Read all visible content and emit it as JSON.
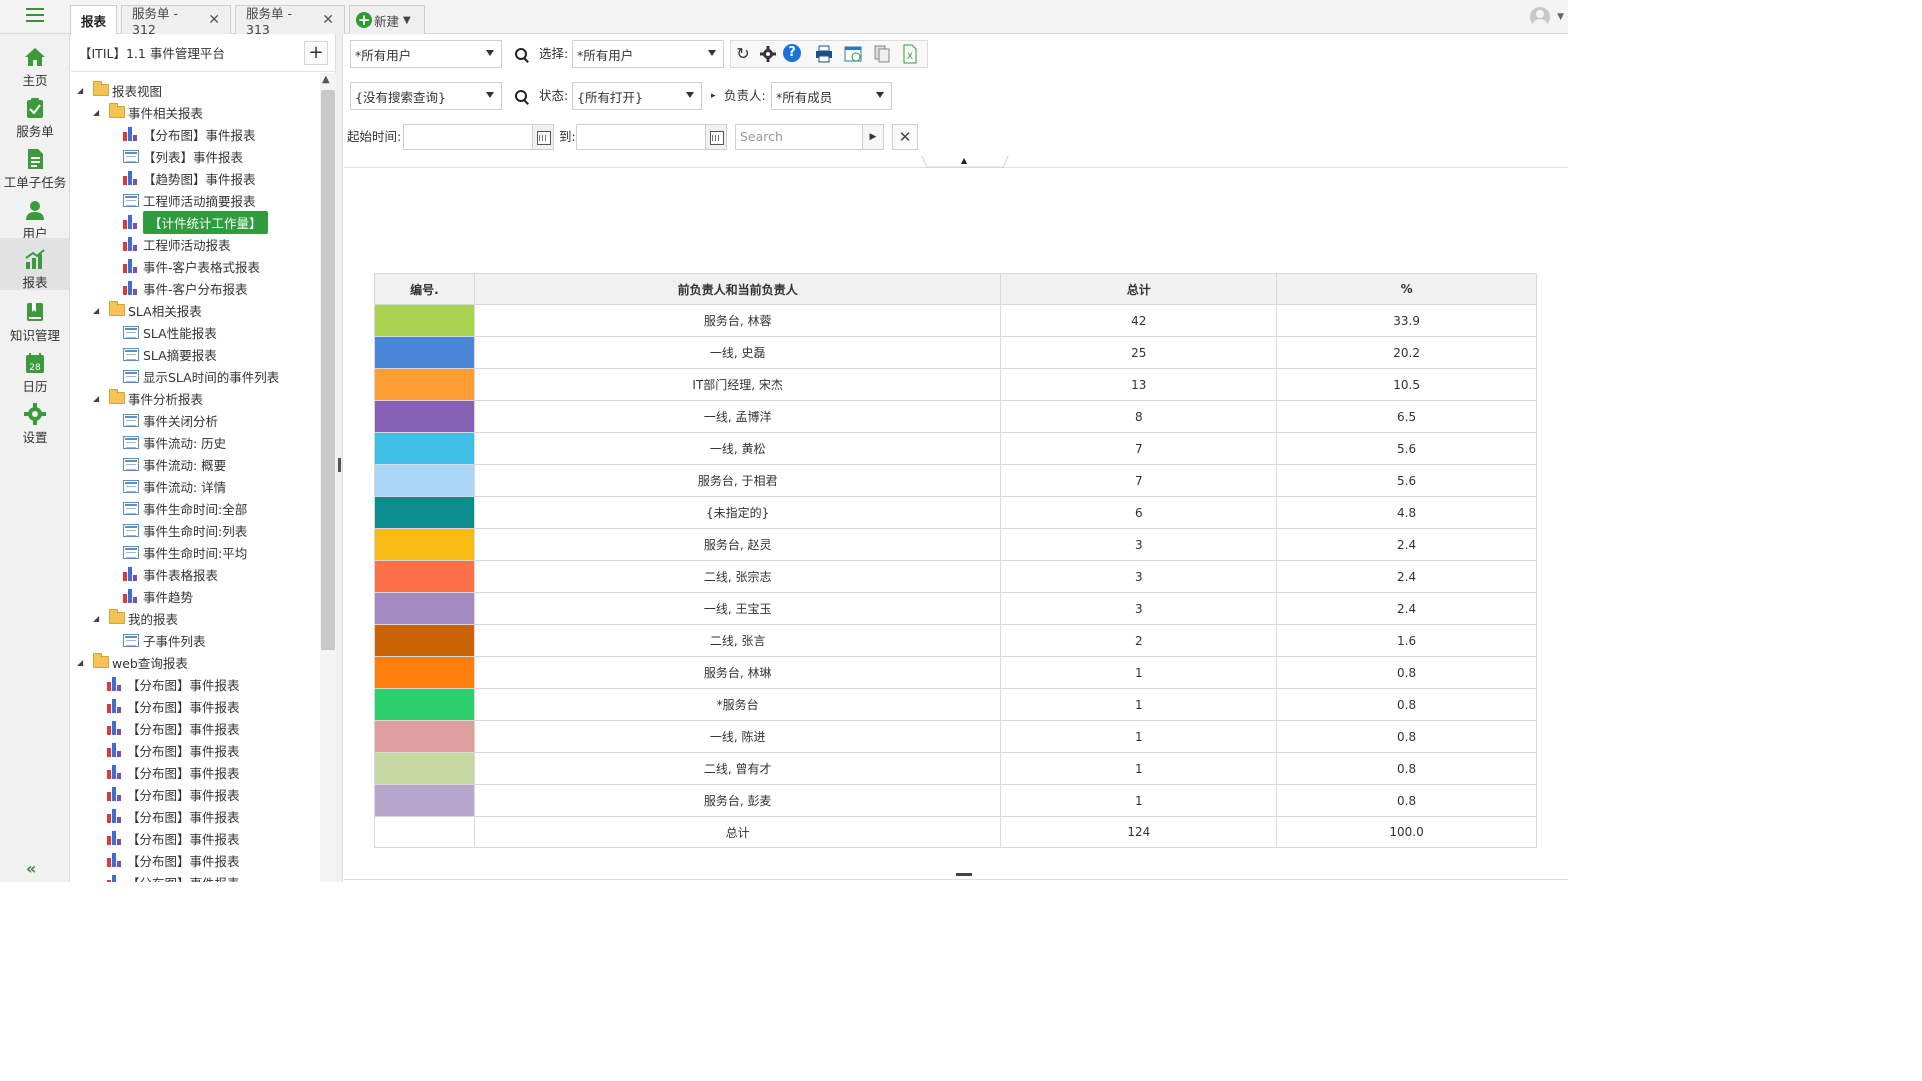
{
  "tabs": [
    {
      "label": "报表",
      "active": true,
      "closable": false
    },
    {
      "label": "服务单 - 312",
      "closable": true
    },
    {
      "label": "服务单 - 313",
      "closable": true
    }
  ],
  "new_tab_label": "新建",
  "close_glyph": "✕",
  "left_nav": [
    {
      "label": "主页",
      "icon": "home-icon"
    },
    {
      "label": "服务单",
      "icon": "clipboard-icon"
    },
    {
      "label": "工单子任务",
      "icon": "document-icon"
    },
    {
      "label": "用户",
      "icon": "user-icon"
    },
    {
      "label": "报表",
      "icon": "bar-chart-icon",
      "active": true
    },
    {
      "label": "知识管理",
      "icon": "book-icon"
    },
    {
      "label": "日历",
      "icon": "calendar-icon"
    },
    {
      "label": "设置",
      "icon": "gear-icon"
    }
  ],
  "calendar_day": "28",
  "collapse_glyph": "«",
  "tree": {
    "title": "【ITIL】1.1 事件管理平台",
    "add_glyph": "+",
    "items": [
      {
        "label": "报表视图",
        "level": 0,
        "type": "folder"
      },
      {
        "label": "事件相关报表",
        "level": 1,
        "type": "folder"
      },
      {
        "label": "【分布图】事件报表",
        "level": 2,
        "type": "chart"
      },
      {
        "label": "【列表】事件报表",
        "level": 2,
        "type": "list"
      },
      {
        "label": "【趋势图】事件报表",
        "level": 2,
        "type": "chart"
      },
      {
        "label": "工程师活动摘要报表",
        "level": 2,
        "type": "list"
      },
      {
        "label": "【计件统计工作量】",
        "level": 2,
        "type": "chart",
        "selected": true
      },
      {
        "label": "工程师活动报表",
        "level": 2,
        "type": "chart"
      },
      {
        "label": "事件-客户表格式报表",
        "level": 2,
        "type": "chart"
      },
      {
        "label": "事件-客户分布报表",
        "level": 2,
        "type": "chart"
      },
      {
        "label": "SLA相关报表",
        "level": 1,
        "type": "folder"
      },
      {
        "label": "SLA性能报表",
        "level": 2,
        "type": "list"
      },
      {
        "label": "SLA摘要报表",
        "level": 2,
        "type": "list"
      },
      {
        "label": "显示SLA时间的事件列表",
        "level": 2,
        "type": "list"
      },
      {
        "label": "事件分析报表",
        "level": 1,
        "type": "folder"
      },
      {
        "label": "事件关闭分析",
        "level": 2,
        "type": "list"
      },
      {
        "label": "事件流动: 历史",
        "level": 2,
        "type": "list"
      },
      {
        "label": "事件流动: 概要",
        "level": 2,
        "type": "list"
      },
      {
        "label": "事件流动: 详情",
        "level": 2,
        "type": "list"
      },
      {
        "label": "事件生命时间:全部",
        "level": 2,
        "type": "list"
      },
      {
        "label": "事件生命时间:列表",
        "level": 2,
        "type": "list"
      },
      {
        "label": "事件生命时间:平均",
        "level": 2,
        "type": "list"
      },
      {
        "label": "事件表格报表",
        "level": 2,
        "type": "chart"
      },
      {
        "label": "事件趋势",
        "level": 2,
        "type": "chart"
      },
      {
        "label": "我的报表",
        "level": 1,
        "type": "folder"
      },
      {
        "label": "子事件列表",
        "level": 2,
        "type": "list"
      },
      {
        "label": "web查询报表",
        "level": 0,
        "type": "folder"
      },
      {
        "label": "【分布图】事件报表",
        "level": 1,
        "type": "chart"
      },
      {
        "label": "【分布图】事件报表",
        "level": 1,
        "type": "chart"
      },
      {
        "label": "【分布图】事件报表",
        "level": 1,
        "type": "chart"
      },
      {
        "label": "【分布图】事件报表",
        "level": 1,
        "type": "chart"
      },
      {
        "label": "【分布图】事件报表",
        "level": 1,
        "type": "chart"
      },
      {
        "label": "【分布图】事件报表",
        "level": 1,
        "type": "chart"
      },
      {
        "label": "【分布图】事件报表",
        "level": 1,
        "type": "chart"
      },
      {
        "label": "【分布图】事件报表",
        "level": 1,
        "type": "chart"
      },
      {
        "label": "【分布图】事件报表",
        "level": 1,
        "type": "chart"
      },
      {
        "label": "【分布图】事件报表",
        "level": 1,
        "type": "chart"
      }
    ]
  },
  "filters": {
    "user_select": "*所有用户",
    "choose_label": "选择:",
    "choose_select": "*所有用户",
    "query_select": "{没有搜索查询}",
    "status_label": "状态:",
    "status_select": "{所有打开}",
    "owner_label": "负责人:",
    "owner_select": "*所有成员",
    "start_label": "起始时间:",
    "to_label": "到:",
    "search_placeholder": "Search",
    "expand_glyph": "▸",
    "go_glyph": "▶",
    "clear_glyph": "✕",
    "collapse_glyph": "▲",
    "help_glyph": "?"
  },
  "table": {
    "headers": [
      "编号.",
      "前负责人和当前负责人",
      "总计",
      "%"
    ],
    "rows": [
      {
        "color": "#a8d44f",
        "name": "服务台, 林蓉",
        "total": "42",
        "pct": "33.9"
      },
      {
        "color": "#4a86d8",
        "name": "一线, 史磊",
        "total": "25",
        "pct": "20.2"
      },
      {
        "color": "#ff9d35",
        "name": "IT部门经理, 宋杰",
        "total": "13",
        "pct": "10.5"
      },
      {
        "color": "#8660b4",
        "name": "一线, 孟博洋",
        "total": "8",
        "pct": "6.5"
      },
      {
        "color": "#3ebee3",
        "name": "一线, 黄松",
        "total": "7",
        "pct": "5.6"
      },
      {
        "color": "#a9d5f7",
        "name": "服务台, 于相君",
        "total": "7",
        "pct": "5.6"
      },
      {
        "color": "#0b8d8d",
        "name": "{未指定的}",
        "total": "6",
        "pct": "4.8"
      },
      {
        "color": "#f7bb14",
        "name": "服务台, 赵灵",
        "total": "3",
        "pct": "2.4"
      },
      {
        "color": "#fb7046",
        "name": "二线, 张宗志",
        "total": "3",
        "pct": "2.4"
      },
      {
        "color": "#a38bc2",
        "name": "一线, 王宝玉",
        "total": "3",
        "pct": "2.4"
      },
      {
        "color": "#c96306",
        "name": "二线, 张言",
        "total": "2",
        "pct": "1.6"
      },
      {
        "color": "#ff7f0d",
        "name": "服务台, 林琳",
        "total": "1",
        "pct": "0.8"
      },
      {
        "color": "#2dd06f",
        "name": "*服务台",
        "total": "1",
        "pct": "0.8"
      },
      {
        "color": "#dc9f9d",
        "name": "一线, 陈进",
        "total": "1",
        "pct": "0.8"
      },
      {
        "color": "#c7d9a3",
        "name": "二线, 曾有才",
        "total": "1",
        "pct": "0.8"
      },
      {
        "color": "#b7a7cc",
        "name": "服务台, 彭麦",
        "total": "1",
        "pct": "0.8"
      }
    ],
    "footer": {
      "name": "总计",
      "total": "124",
      "pct": "100.0"
    }
  }
}
